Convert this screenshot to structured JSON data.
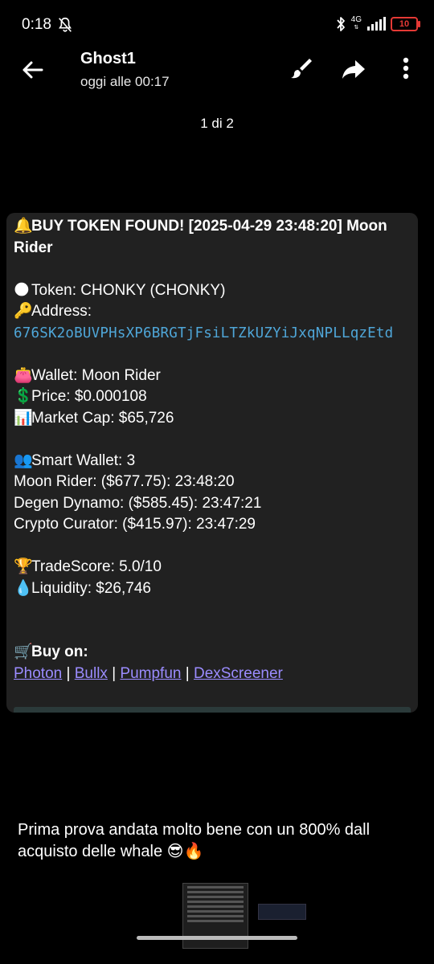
{
  "status_bar": {
    "time": "0:18",
    "network": "4G",
    "battery": "10",
    "icons": [
      "do-not-disturb-icon",
      "bluetooth-icon",
      "signal-icon",
      "battery-icon"
    ],
    "battery_color": "#e53935"
  },
  "header": {
    "sender": "Ghost1",
    "timestamp": "oggi alle 00:17",
    "icons": [
      "back-arrow-icon",
      "brush-icon",
      "share-icon",
      "more-vert-icon"
    ]
  },
  "pager": {
    "counter": "1 di 2"
  },
  "message": {
    "title_emoji": "🔔",
    "title": "BUY TOKEN FOUND! [2025-04-29 23:48:20] Moon Rider",
    "token_emoji": "🌑",
    "token": "Token: CHONKY (CHONKY)",
    "address_emoji": "🔑",
    "address_label": "Address:",
    "address": "676SK2oBUVPHsXP6BRGTjFsiLTZkUZYiJxqNPLLqzEtd",
    "wallet_emoji": "👛",
    "wallet": "Wallet: Moon Rider",
    "price_emoji": "💲",
    "price": "Price: $0.000108",
    "mcap_emoji": "📊",
    "market_cap": "Market Cap: $65,726",
    "smart_emoji": "👥",
    "smart_wallet": "Smart Wallet: 3",
    "buys": [
      "Moon Rider: ($677.75): 23:48:20",
      "Degen Dynamo: ($585.45): 23:47:21",
      "Crypto Curator: ($415.97): 23:47:29"
    ],
    "score_emoji": "🏆",
    "trade_score": "TradeScore: 5.0/10",
    "liq_emoji": "💧",
    "liquidity": "Liquidity: $26,746",
    "buy_emoji": "🛒",
    "buy_on": "Buy on:",
    "links": [
      "Photon",
      "Bullx",
      "Pumpfun",
      "DexScreener"
    ],
    "separator": " | "
  },
  "caption": "Prima prova  andata molto bene con un 800% dall acquisto delle whale 😎🔥",
  "colors": {
    "background": "#000000",
    "card": "#212121",
    "address": "#4fa6d8",
    "link": "#9b8cff"
  }
}
